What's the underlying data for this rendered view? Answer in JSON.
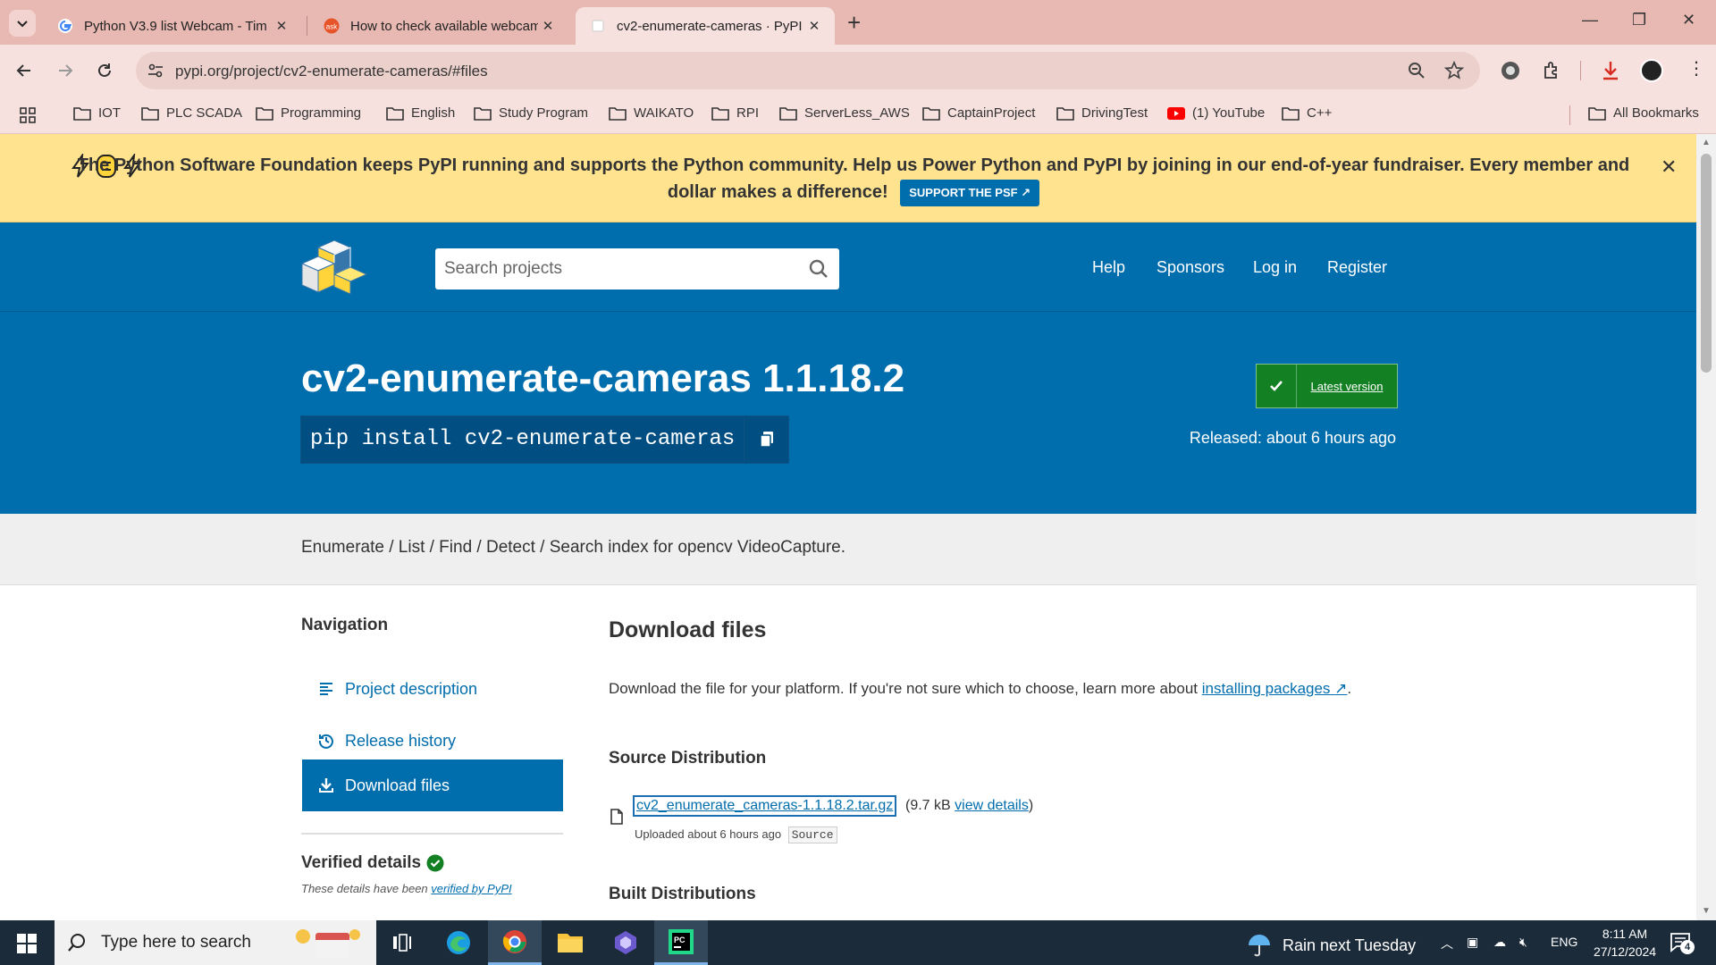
{
  "browser": {
    "tabs": [
      {
        "title": "Python V3.9 list Webcam - Tim",
        "icon": "google-icon"
      },
      {
        "title": "How to check available webcam",
        "icon": "ask-icon"
      },
      {
        "title": "cv2-enumerate-cameras · PyPI",
        "icon": "pypi-icon"
      }
    ],
    "url": "pypi.org/project/cv2-enumerate-cameras/#files",
    "bookmarks": [
      "IOT",
      "PLC SCADA",
      "Programming",
      "English",
      "Study Program",
      "WAIKATO",
      "RPI",
      "ServerLess_AWS",
      "CaptainProject",
      "DrivingTest",
      "(1) YouTube",
      "C++"
    ],
    "all_bookmarks": "All Bookmarks"
  },
  "banner": {
    "text": "The Python Software Foundation keeps PyPI running and supports the Python community. Help us Power Python and PyPI by joining in our end-of-year fundraiser. Every member and dollar makes a difference!",
    "button": "SUPPORT THE PSF"
  },
  "header": {
    "search_placeholder": "Search projects",
    "nav": [
      "Help",
      "Sponsors",
      "Log in",
      "Register"
    ]
  },
  "project": {
    "title": "cv2-enumerate-cameras 1.1.18.2",
    "pip": "pip install cv2-enumerate-cameras",
    "latest_label": "Latest version",
    "released": "Released: about 6 hours ago",
    "summary": "Enumerate / List / Find / Detect / Search index for opencv VideoCapture."
  },
  "sidebar": {
    "heading": "Navigation",
    "items": [
      {
        "label": "Project description",
        "icon": "align-left-icon"
      },
      {
        "label": "Release history",
        "icon": "history-icon"
      },
      {
        "label": "Download files",
        "icon": "download-icon"
      }
    ],
    "verified_heading": "Verified details",
    "verified_note_prefix": "These details have been",
    "verified_link": "verified by PyPI"
  },
  "main": {
    "heading": "Download files",
    "intro_prefix": "Download the file for your platform. If you're not sure which to choose, learn more about",
    "intro_link": "installing packages",
    "intro_suffix": ".",
    "source_heading": "Source Distribution",
    "file": {
      "name": "cv2_enumerate_cameras-1.1.18.2.tar.gz",
      "size": "(9.7 kB",
      "details": "view details",
      "close": ")",
      "uploaded": "Uploaded about 6 hours ago",
      "badge": "Source"
    },
    "built_heading": "Built Distributions"
  },
  "taskbar": {
    "search": "Type here to search",
    "weather": "Rain next Tuesday",
    "lang": "ENG",
    "time": "8:11 AM",
    "date": "27/12/2024",
    "notif_count": "4"
  },
  "colors": {
    "pypi_blue": "#006dad",
    "banner_yellow": "#ffe38f",
    "latest_green": "#148024",
    "tab_strip": "#e8b8b2"
  }
}
